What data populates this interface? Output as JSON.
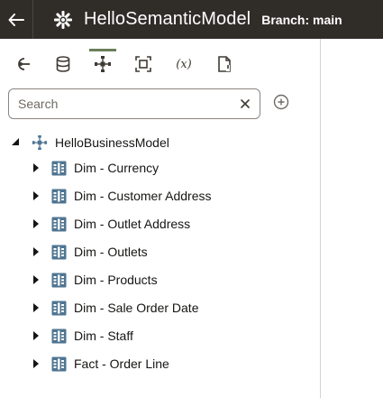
{
  "header": {
    "title": "HelloSemanticModel",
    "branch": "Branch: main",
    "back_icon": "arrow-left-icon",
    "model_icon": "semantic-model-icon"
  },
  "toolbar": {
    "tools": [
      {
        "name": "physical-layer",
        "icon": "physical-layer-icon"
      },
      {
        "name": "database",
        "icon": "database-icon"
      },
      {
        "name": "logical-layer",
        "icon": "logical-layer-icon",
        "active": true
      },
      {
        "name": "presentation-layer",
        "icon": "presentation-layer-icon"
      },
      {
        "name": "variables",
        "icon": "variables-icon",
        "text": "(x)"
      },
      {
        "name": "document",
        "icon": "document-icon"
      }
    ],
    "active_color": "#6a7f5a"
  },
  "search": {
    "placeholder": "Search",
    "value": ""
  },
  "tree": {
    "root_label": "HelloBusinessModel",
    "items": [
      "Dim - Currency",
      "Dim - Customer Address",
      "Dim - Outlet Address",
      "Dim - Outlets",
      "Dim - Products",
      "Dim - Sale Order Date",
      "Dim - Staff",
      "Fact - Order Line"
    ]
  },
  "colors": {
    "header_bg": "#302c28",
    "icon_blue": "#4f7592"
  }
}
